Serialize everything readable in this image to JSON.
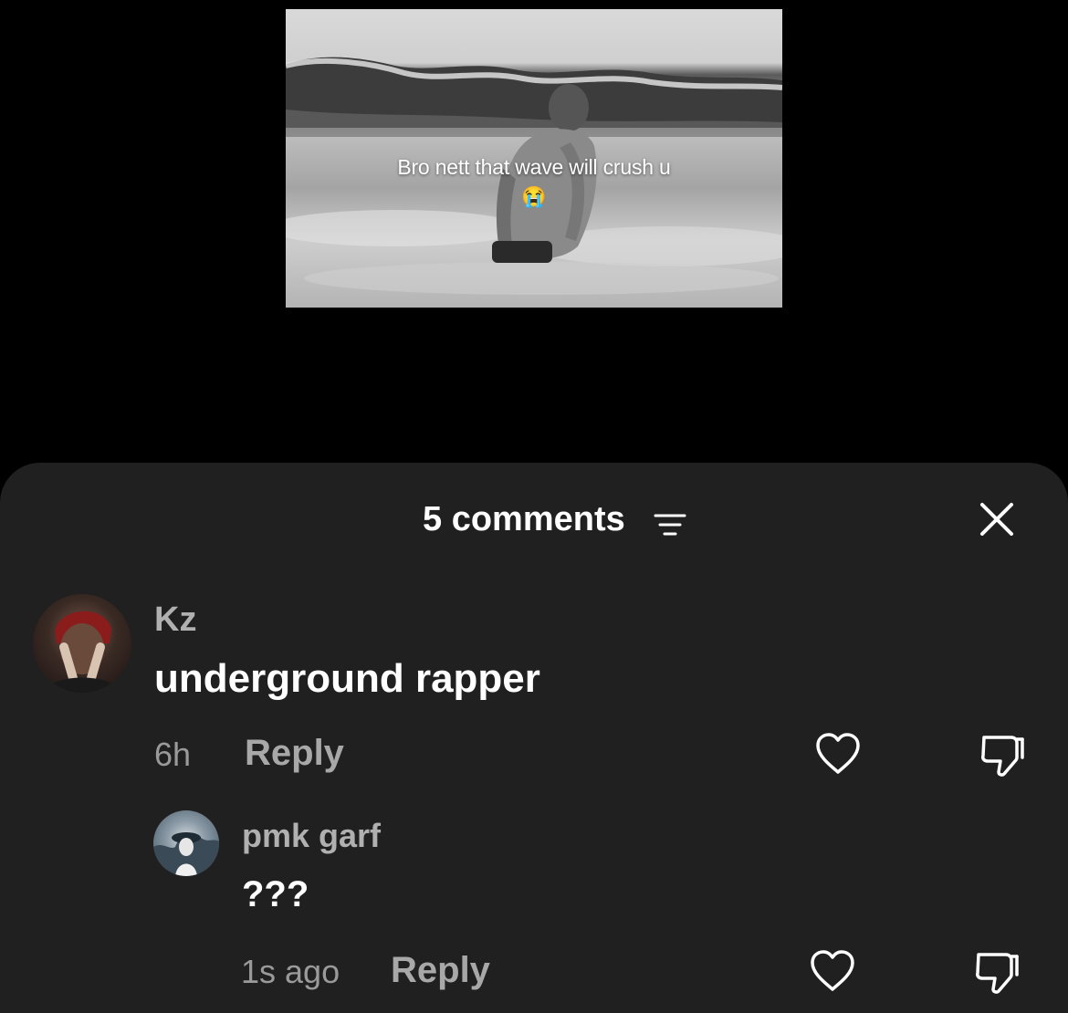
{
  "video": {
    "caption": "Bro nett that wave will crush u",
    "caption_emoji": "😭"
  },
  "comments_panel": {
    "count_label": "5 comments",
    "comments": [
      {
        "author": "Kz",
        "text": "underground rapper",
        "time": "6h",
        "reply_label": "Reply"
      },
      {
        "author": "pmk garf",
        "text": "???",
        "time": "1s ago",
        "reply_label": "Reply"
      }
    ]
  },
  "icons": {
    "filter": "filter-lines-icon",
    "close": "close-icon",
    "like": "heart-outline-icon",
    "dislike": "thumbs-down-outline-icon"
  },
  "colors": {
    "sheet_bg": "#202020",
    "secondary_text": "#a8a8a8"
  }
}
